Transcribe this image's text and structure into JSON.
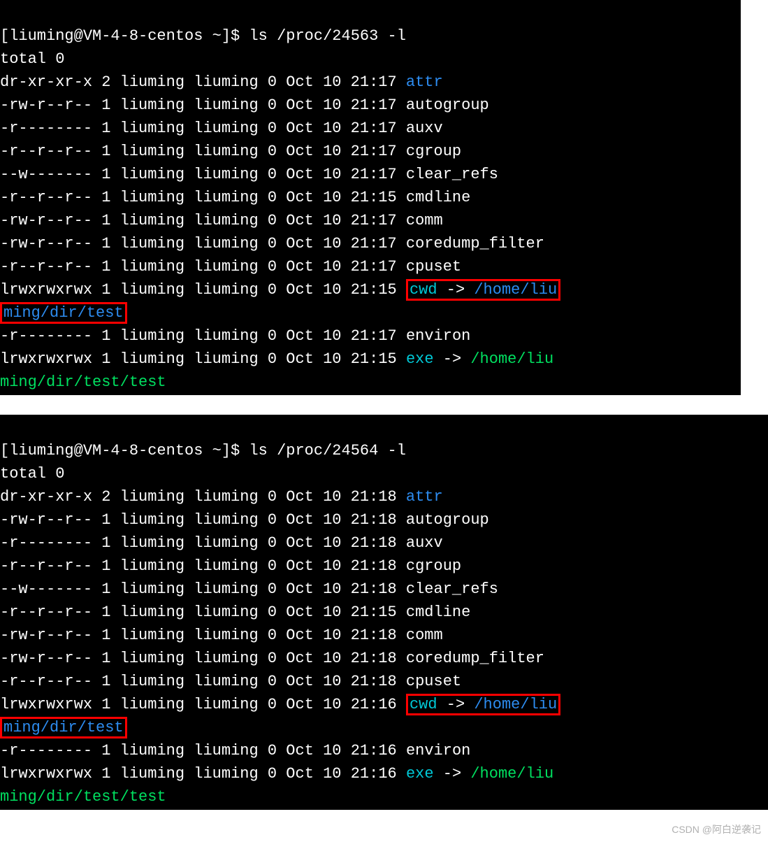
{
  "term1": {
    "prompt_user": "[liuming@VM-4-8-centos ~]$ ",
    "cmd": "ls /proc/24563 -l",
    "total": "total 0",
    "rows": [
      {
        "perm": "dr-xr-xr-x",
        "n": "2",
        "u": "liuming",
        "g": "liuming",
        "s": "0",
        "d": "Oct 10 21:17",
        "name": "attr",
        "cls": "blue"
      },
      {
        "perm": "-rw-r--r--",
        "n": "1",
        "u": "liuming",
        "g": "liuming",
        "s": "0",
        "d": "Oct 10 21:17",
        "name": "autogroup",
        "cls": "white"
      },
      {
        "perm": "-r--------",
        "n": "1",
        "u": "liuming",
        "g": "liuming",
        "s": "0",
        "d": "Oct 10 21:17",
        "name": "auxv",
        "cls": "white"
      },
      {
        "perm": "-r--r--r--",
        "n": "1",
        "u": "liuming",
        "g": "liuming",
        "s": "0",
        "d": "Oct 10 21:17",
        "name": "cgroup",
        "cls": "white"
      },
      {
        "perm": "--w-------",
        "n": "1",
        "u": "liuming",
        "g": "liuming",
        "s": "0",
        "d": "Oct 10 21:17",
        "name": "clear_refs",
        "cls": "white"
      },
      {
        "perm": "-r--r--r--",
        "n": "1",
        "u": "liuming",
        "g": "liuming",
        "s": "0",
        "d": "Oct 10 21:15",
        "name": "cmdline",
        "cls": "white"
      },
      {
        "perm": "-rw-r--r--",
        "n": "1",
        "u": "liuming",
        "g": "liuming",
        "s": "0",
        "d": "Oct 10 21:17",
        "name": "comm",
        "cls": "white"
      },
      {
        "perm": "-rw-r--r--",
        "n": "1",
        "u": "liuming",
        "g": "liuming",
        "s": "0",
        "d": "Oct 10 21:17",
        "name": "coredump_filter",
        "cls": "white"
      },
      {
        "perm": "-r--r--r--",
        "n": "1",
        "u": "liuming",
        "g": "liuming",
        "s": "0",
        "d": "Oct 10 21:17",
        "name": "cpuset",
        "cls": "white"
      }
    ],
    "cwd_row": {
      "perm": "lrwxrwxrwx",
      "n": "1",
      "u": "liuming",
      "g": "liuming",
      "s": "0",
      "d": "Oct 10 21:15",
      "link": "cwd",
      "arrow": " -> ",
      "target1": "/home/liu",
      "target2": "ming/dir/test"
    },
    "environ": {
      "perm": "-r--------",
      "n": "1",
      "u": "liuming",
      "g": "liuming",
      "s": "0",
      "d": "Oct 10 21:17",
      "name": "environ"
    },
    "exe_row": {
      "perm": "lrwxrwxrwx",
      "n": "1",
      "u": "liuming",
      "g": "liuming",
      "s": "0",
      "d": "Oct 10 21:15",
      "link": "exe",
      "arrow": " -> ",
      "target1": "/home/liu",
      "target2": "ming/dir/test/test"
    }
  },
  "term2": {
    "prompt_user": "[liuming@VM-4-8-centos ~]$ ",
    "cmd": "ls /proc/24564 -l",
    "total": "total 0",
    "rows": [
      {
        "perm": "dr-xr-xr-x",
        "n": "2",
        "u": "liuming",
        "g": "liuming",
        "s": "0",
        "d": "Oct 10 21:18",
        "name": "attr",
        "cls": "blue"
      },
      {
        "perm": "-rw-r--r--",
        "n": "1",
        "u": "liuming",
        "g": "liuming",
        "s": "0",
        "d": "Oct 10 21:18",
        "name": "autogroup",
        "cls": "white"
      },
      {
        "perm": "-r--------",
        "n": "1",
        "u": "liuming",
        "g": "liuming",
        "s": "0",
        "d": "Oct 10 21:18",
        "name": "auxv",
        "cls": "white"
      },
      {
        "perm": "-r--r--r--",
        "n": "1",
        "u": "liuming",
        "g": "liuming",
        "s": "0",
        "d": "Oct 10 21:18",
        "name": "cgroup",
        "cls": "white"
      },
      {
        "perm": "--w-------",
        "n": "1",
        "u": "liuming",
        "g": "liuming",
        "s": "0",
        "d": "Oct 10 21:18",
        "name": "clear_refs",
        "cls": "white"
      },
      {
        "perm": "-r--r--r--",
        "n": "1",
        "u": "liuming",
        "g": "liuming",
        "s": "0",
        "d": "Oct 10 21:15",
        "name": "cmdline",
        "cls": "white"
      },
      {
        "perm": "-rw-r--r--",
        "n": "1",
        "u": "liuming",
        "g": "liuming",
        "s": "0",
        "d": "Oct 10 21:18",
        "name": "comm",
        "cls": "white"
      },
      {
        "perm": "-rw-r--r--",
        "n": "1",
        "u": "liuming",
        "g": "liuming",
        "s": "0",
        "d": "Oct 10 21:18",
        "name": "coredump_filter",
        "cls": "white"
      },
      {
        "perm": "-r--r--r--",
        "n": "1",
        "u": "liuming",
        "g": "liuming",
        "s": "0",
        "d": "Oct 10 21:18",
        "name": "cpuset",
        "cls": "white"
      }
    ],
    "cwd_row": {
      "perm": "lrwxrwxrwx",
      "n": "1",
      "u": "liuming",
      "g": "liuming",
      "s": "0",
      "d": "Oct 10 21:16",
      "link": "cwd",
      "arrow": " -> ",
      "target1": "/home/liu",
      "target2": "ming/dir/test"
    },
    "environ": {
      "perm": "-r--------",
      "n": "1",
      "u": "liuming",
      "g": "liuming",
      "s": "0",
      "d": "Oct 10 21:16",
      "name": "environ"
    },
    "exe_row": {
      "perm": "lrwxrwxrwx",
      "n": "1",
      "u": "liuming",
      "g": "liuming",
      "s": "0",
      "d": "Oct 10 21:16",
      "link": "exe",
      "arrow": " -> ",
      "target1": "/home/liu",
      "target2": "ming/dir/test/test"
    }
  },
  "footer": "CSDN @阿白逆袭记"
}
